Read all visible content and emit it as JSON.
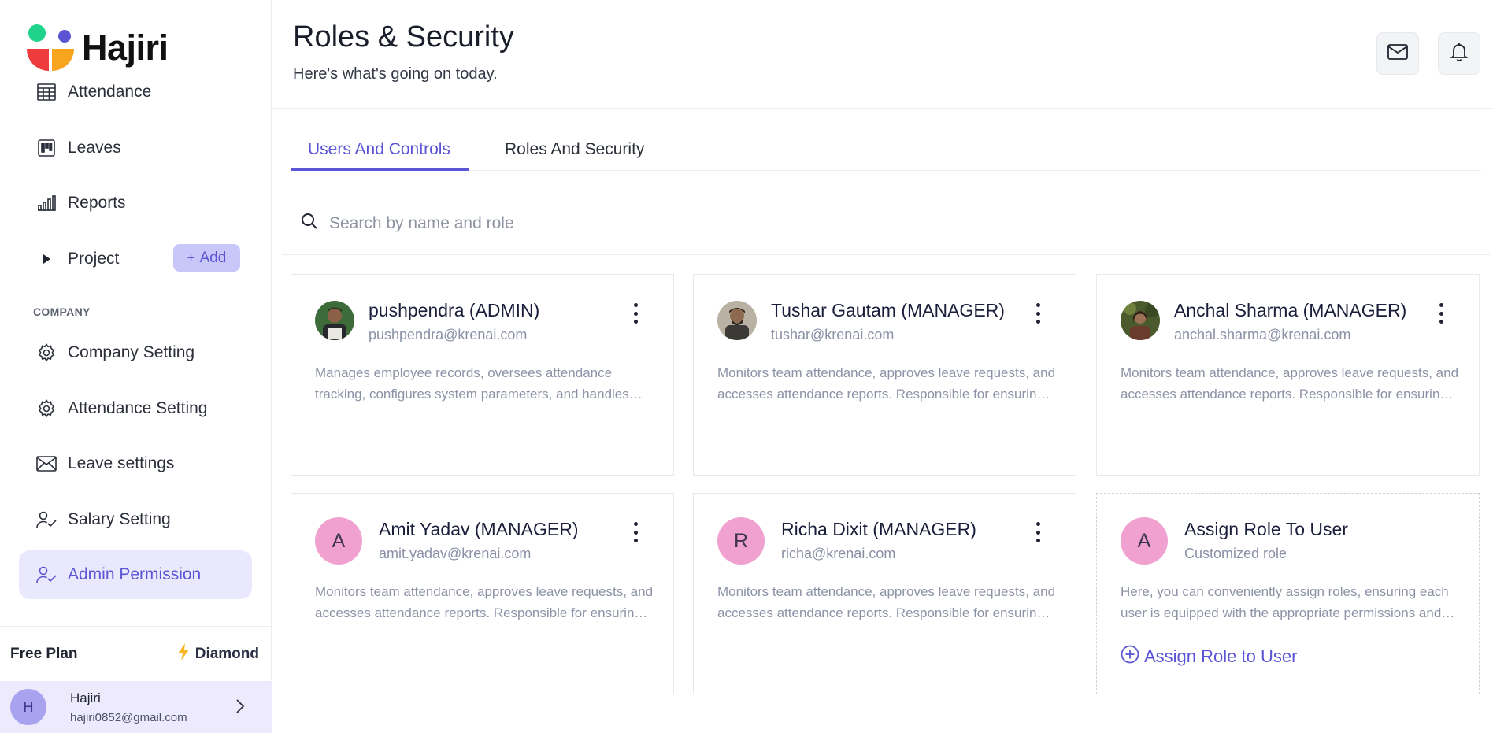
{
  "app": {
    "name": "Hajiri"
  },
  "sidebar": {
    "items": [
      {
        "label": "Attendance",
        "icon": "table-icon"
      },
      {
        "label": "Leaves",
        "icon": "kanban-icon"
      },
      {
        "label": "Reports",
        "icon": "bar-chart-icon"
      },
      {
        "label": "Project",
        "icon": "play-icon",
        "add_label": "Add"
      }
    ],
    "section_label": "COMPANY",
    "company_items": [
      {
        "label": "Company Setting",
        "icon": "gear-icon"
      },
      {
        "label": "Attendance Setting",
        "icon": "gear-icon"
      },
      {
        "label": "Leave settings",
        "icon": "mail-icon"
      },
      {
        "label": "Salary Setting",
        "icon": "user-check-icon"
      },
      {
        "label": "Admin Permission",
        "icon": "user-check-icon",
        "active": true
      }
    ],
    "plan": {
      "free": "Free Plan",
      "tier": "Diamond"
    },
    "user": {
      "initial": "H",
      "name": "Hajiri",
      "email": "hajiri0852@gmail.com"
    }
  },
  "header": {
    "title": "Roles & Security",
    "subtitle": "Here's what's going on today."
  },
  "tabs": [
    {
      "label": "Users And Controls",
      "active": true
    },
    {
      "label": "Roles And Security",
      "active": false
    }
  ],
  "search": {
    "placeholder": "Search by name and role",
    "value": ""
  },
  "cards": [
    {
      "name": "pushpendra (ADMIN)",
      "email": "pushpendra@krenai.com",
      "desc1": "Manages employee records, oversees attendance",
      "desc2": "tracking, configures system parameters, and handles…"
    },
    {
      "name": "Tushar Gautam (MANAGER)",
      "email": "tushar@krenai.com",
      "desc1": "Monitors team attendance, approves leave requests, and",
      "desc2": "accesses attendance reports. Responsible for ensuring…"
    },
    {
      "name": "Anchal Sharma (MANAGER)",
      "email": "anchal.sharma@krenai.com",
      "desc1": "Monitors team attendance, approves leave requests, and",
      "desc2": "accesses attendance reports. Responsible for ensuring…"
    },
    {
      "initial": "A",
      "name": "Amit Yadav (MANAGER)",
      "email": "amit.yadav@krenai.com",
      "desc1": "Monitors team attendance, approves leave requests, and",
      "desc2": "accesses attendance reports. Responsible for ensuring…"
    },
    {
      "initial": "R",
      "name": "Richa Dixit (MANAGER)",
      "email": "richa@krenai.com",
      "desc1": "Monitors team attendance, approves leave requests, and",
      "desc2": "accesses attendance reports. Responsible for ensuring…"
    }
  ],
  "assign_card": {
    "initial": "A",
    "title": "Assign Role To User",
    "subtitle": "Customized role",
    "desc1": "Here, you can conveniently assign roles, ensuring each",
    "desc2": "user is equipped with the appropriate permissions and…",
    "link": "Assign Role to User"
  },
  "colors": {
    "accent": "#5b55d6",
    "active_bg": "#e9e8fc",
    "avatar_pink": "#f0a1cf"
  }
}
